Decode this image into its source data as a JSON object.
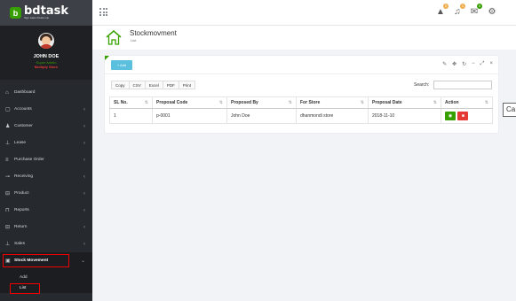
{
  "brand": {
    "name": "bdtask",
    "tagline": "Sign sales Pedal one"
  },
  "user": {
    "name": "JOHN DOE",
    "status": "Super Admin",
    "shop": "Multiply Store"
  },
  "sidebar": {
    "items": [
      {
        "label": "Dashboard",
        "icon": "home-icon",
        "glyph": "⌂",
        "chevron": false
      },
      {
        "label": "Accounts",
        "icon": "bank-icon",
        "glyph": "▢",
        "chevron": true
      },
      {
        "label": "Customer",
        "icon": "user-icon",
        "glyph": "♟",
        "chevron": true
      },
      {
        "label": "Lease",
        "icon": "cart-icon",
        "glyph": "⊥",
        "chevron": true
      },
      {
        "label": "Purchase Order",
        "icon": "list-icon",
        "glyph": "≡",
        "chevron": true
      },
      {
        "label": "Receiving",
        "icon": "truck-icon",
        "glyph": "⊸",
        "chevron": true
      },
      {
        "label": "Product",
        "icon": "box-icon",
        "glyph": "⊟",
        "chevron": true
      },
      {
        "label": "Reports",
        "icon": "chart-icon",
        "glyph": "⊓",
        "chevron": true
      },
      {
        "label": "Return",
        "icon": "return-icon",
        "glyph": "⊟",
        "chevron": true
      },
      {
        "label": "Sales",
        "icon": "sales-icon",
        "glyph": "⊥",
        "chevron": true
      }
    ],
    "active": {
      "label": "Stock Movement",
      "icon": "stock-icon",
      "glyph": "▣",
      "chevron": "⌄"
    },
    "sub_items": [
      {
        "label": "Add"
      },
      {
        "label": "List"
      }
    ]
  },
  "topbar": {
    "badges": [
      {
        "icon": "warning-icon",
        "glyph": "▲",
        "count": "2",
        "color": "#f0ad4e"
      },
      {
        "icon": "bell-icon",
        "glyph": "♫",
        "count": "1",
        "color": "#f0ad4e"
      },
      {
        "icon": "mail-icon",
        "glyph": "✉",
        "count": "0",
        "color": "#37a000"
      },
      {
        "icon": "gear-icon",
        "glyph": "⚙",
        "count": "",
        "color": ""
      }
    ]
  },
  "page": {
    "title": "Stockmovment",
    "breadcrumb": "List"
  },
  "panel": {
    "add_label": "+ Add",
    "tools": [
      "✎",
      "✥",
      "↻",
      "−",
      "⤢",
      "×"
    ],
    "export_buttons": [
      "Copy",
      "CSV",
      "Excel",
      "PDF",
      "Print"
    ],
    "search_label": "Search:",
    "search_value": ""
  },
  "table": {
    "columns": [
      "SL No.",
      "Proposal Code",
      "Proposed By",
      "For Store",
      "Proposal Date",
      "Action"
    ],
    "rows": [
      [
        "1",
        "p-0001",
        "John Doe",
        "dhanmondi store",
        "2018-11-10"
      ]
    ],
    "actions": [
      {
        "icon": "eye-icon",
        "glyph": "◉",
        "color": "#37a000"
      },
      {
        "icon": "trash-icon",
        "glyph": "■",
        "color": "#e53935"
      }
    ]
  },
  "partial_button_label": "Ca"
}
